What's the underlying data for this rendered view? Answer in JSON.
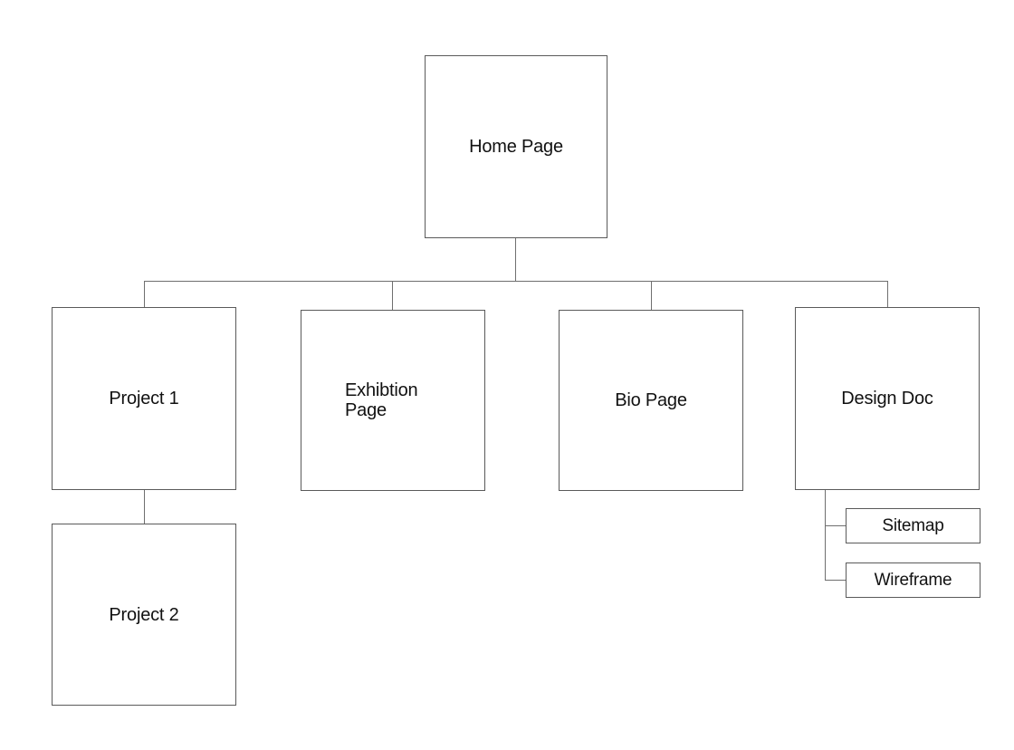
{
  "diagram": {
    "nodes": {
      "home": "Home Page",
      "project1": "Project 1",
      "exhibition": "Exhibtion Page",
      "bio": "Bio Page",
      "design_doc": "Design Doc",
      "project2": "Project 2",
      "sitemap": "Sitemap",
      "wireframe": "Wireframe"
    },
    "colors": {
      "line": "#6f6f6f",
      "border": "#5a5a5a",
      "text": "#111111",
      "background": "#ffffff"
    }
  }
}
